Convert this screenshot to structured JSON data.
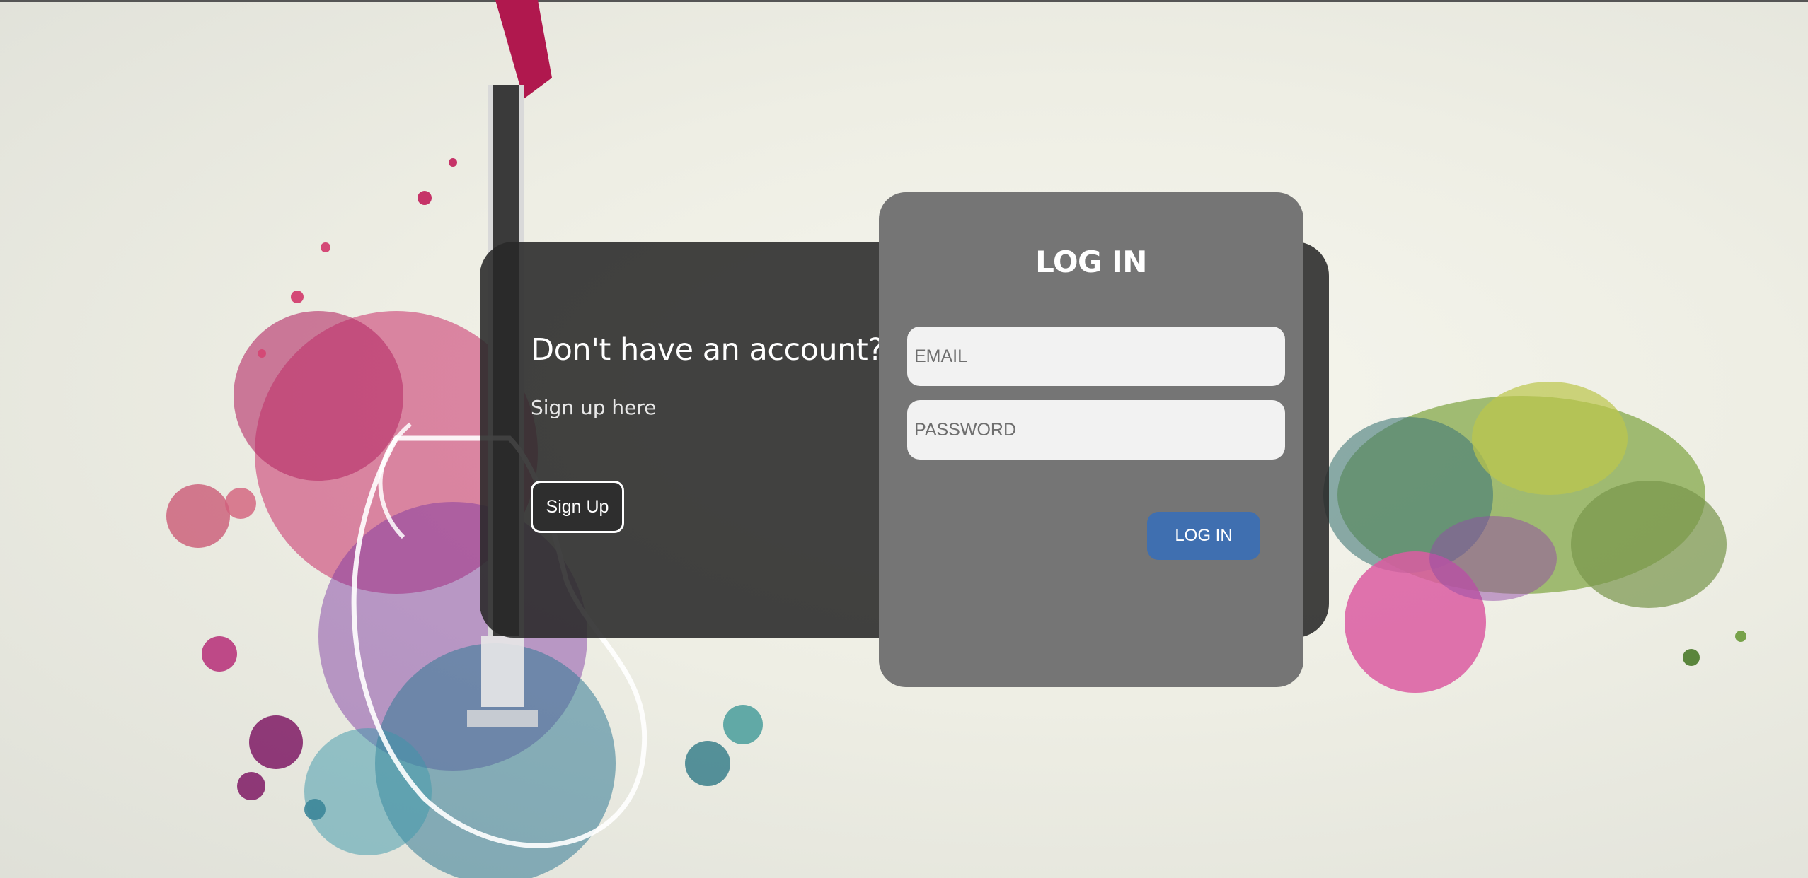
{
  "signup": {
    "heading": "Don't have an account?",
    "subtext": "Sign up here",
    "button_label": "Sign Up"
  },
  "login": {
    "title": "LOG IN",
    "email_placeholder": "EMAIL",
    "password_placeholder": "PASSWORD",
    "button_label": "LOG IN"
  },
  "colors": {
    "login_button": "#3f6fb0",
    "card_background": "#757575",
    "panel_background": "#2e2e2e"
  },
  "background_art": "guitar-paint-splash-illustration"
}
